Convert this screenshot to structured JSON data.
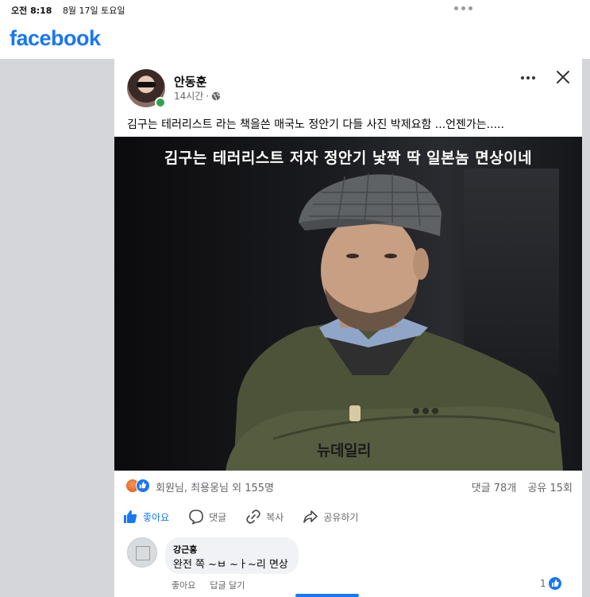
{
  "status_bar": {
    "time": "오전 8:18",
    "date": "8월 17일 토요일"
  },
  "header": {
    "logo_text": "facebook",
    "brand_color": "#1877f2"
  },
  "post": {
    "author": "안동훈",
    "time_ago": "14시간",
    "separator": "·",
    "audience_icon": "globe-icon",
    "text": "김구는 테러리스트  라는 책을쓴 매국노 정안기 다들 사진 박제요함 ...언젠가는.....",
    "photo": {
      "caption": "김구는 테러리스트 저자 정안기 낯짝 딱 일본놈 면상이네",
      "watermark": "뉴데일리"
    },
    "reactions": {
      "icons": [
        "angry-icon",
        "like-icon"
      ],
      "names": "회원님, 최용웅님 외 155명",
      "comments": "댓글 78개",
      "shares": "공유 15회"
    },
    "actions": {
      "like": "좋아요",
      "comment": "댓글",
      "copy": "복사",
      "share": "공유하기"
    }
  },
  "comment": {
    "author": "강근홍",
    "text": "완전 쪽 ~ㅂ ~ㅏ~리 면상",
    "like_action": "좋아요",
    "reply_action": "답글 달기",
    "like_count": "1"
  }
}
